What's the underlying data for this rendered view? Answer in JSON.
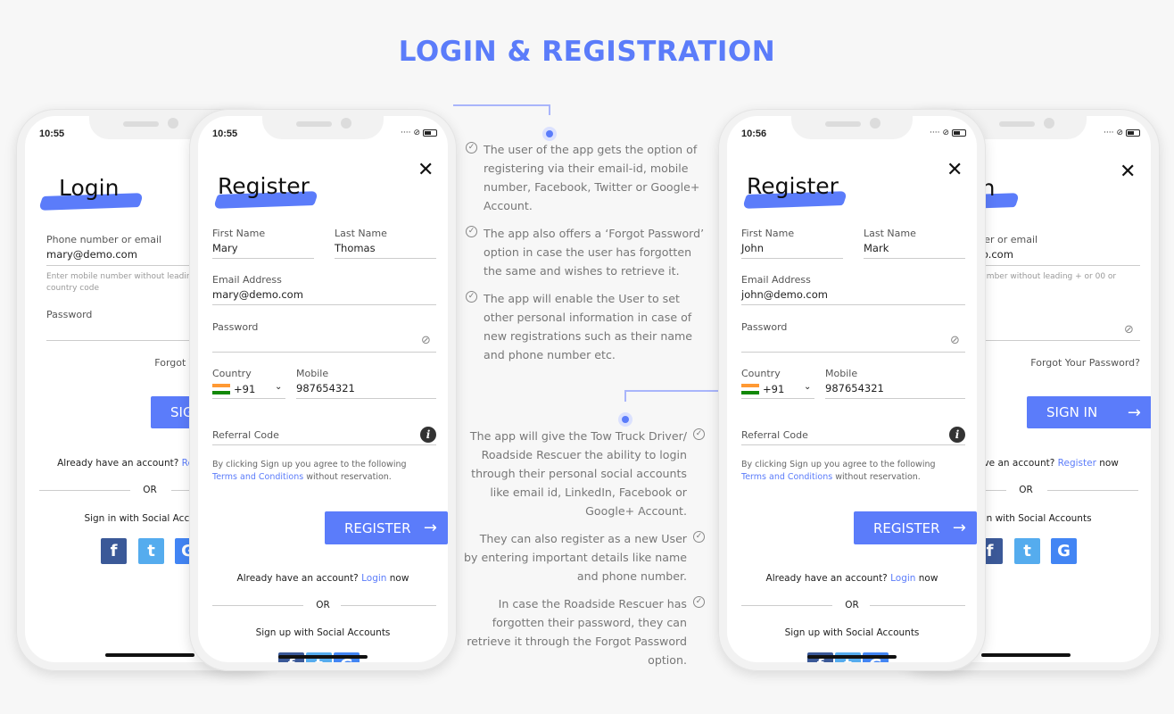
{
  "page_title": "LOGIN & REGISTRATION",
  "accent_color": "#5b7cfa",
  "login_screen": {
    "close_icon": "close-icon",
    "title": "Login",
    "phone_label": "Phone number or email",
    "phone_value": "mary@demo.com",
    "helper_line1": "Enter mobile number without leading + or 00 or",
    "helper_line2": "country code",
    "password_label": "Password",
    "forgot": "Forgot Your Password?",
    "signin": "SIGN IN",
    "already": "Already have an account? ",
    "register_link": "Register",
    "now": " now",
    "or": "OR",
    "social": "Sign in with Social Accounts"
  },
  "register_labels": {
    "title": "Register",
    "first_name": "First Name",
    "last_name": "Last Name",
    "email": "Email Address",
    "password": "Password",
    "country": "Country",
    "country_code": "+91",
    "mobile": "Mobile",
    "referral": "Referral Code",
    "terms_prefix": "By clicking Sign up you agree to the following",
    "terms_link": "Terms and Conditions",
    "terms_suffix": " without reservation.",
    "register_button": "REGISTER",
    "already": "Already have an account? ",
    "login_link": "Login",
    "now": " now",
    "or": "OR",
    "social": "Sign up with Social Accounts"
  },
  "phones": [
    {
      "type": "login",
      "time": "10:55"
    },
    {
      "type": "register",
      "time": "10:55",
      "first_name": "Mary",
      "last_name": "Thomas",
      "email": "mary@demo.com",
      "mobile": "987654321"
    },
    {
      "type": "register",
      "time": "10:56",
      "first_name": "John",
      "last_name": "Mark",
      "email": "john@demo.com",
      "mobile": "987654321"
    },
    {
      "type": "login",
      "time": ""
    }
  ],
  "features_left": [
    "The user of the app gets the option of registering via their email-id, mobile number, Facebook, Twitter or Google+ Account.",
    "The app also offers a ‘Forgot Password’ option in case the user has forgotten the same and wishes to retrieve it.",
    "The app will enable the User to set other personal information in case of new registrations such as their name and phone number etc."
  ],
  "features_right": [
    "The app will give the Tow Truck Driver/ Roadside Rescuer the ability to login through their personal social accounts like email id, LinkedIn, Facebook or Google+ Account.",
    "They can also register as a new User by entering important details like name and phone number.",
    "In case the Roadside Rescuer has forgotten their password, they can retrieve it through the Forgot Password option."
  ]
}
